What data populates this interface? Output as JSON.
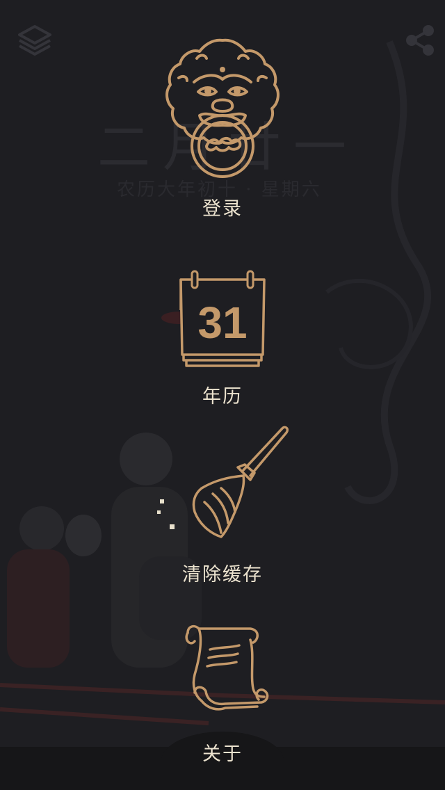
{
  "background": {
    "date_text": "二月廿一",
    "lunar_text": "农历大年初十 · 星期六"
  },
  "toolbar": {
    "layers_icon": "layers-icon",
    "share_icon": "share-icon"
  },
  "menu": {
    "login": {
      "label": "登录",
      "icon": "lion-door-knocker-icon"
    },
    "calendar": {
      "label": "年历",
      "icon": "calendar-icon",
      "day": "31"
    },
    "clear_cache": {
      "label": "清除缓存",
      "icon": "broom-icon"
    },
    "about": {
      "label": "关于",
      "icon": "scroll-icon"
    }
  },
  "colors": {
    "background": "#1e1e22",
    "accent_gold": "#c4996a",
    "label": "#ece3cf",
    "bottom_bar": "#161618"
  }
}
